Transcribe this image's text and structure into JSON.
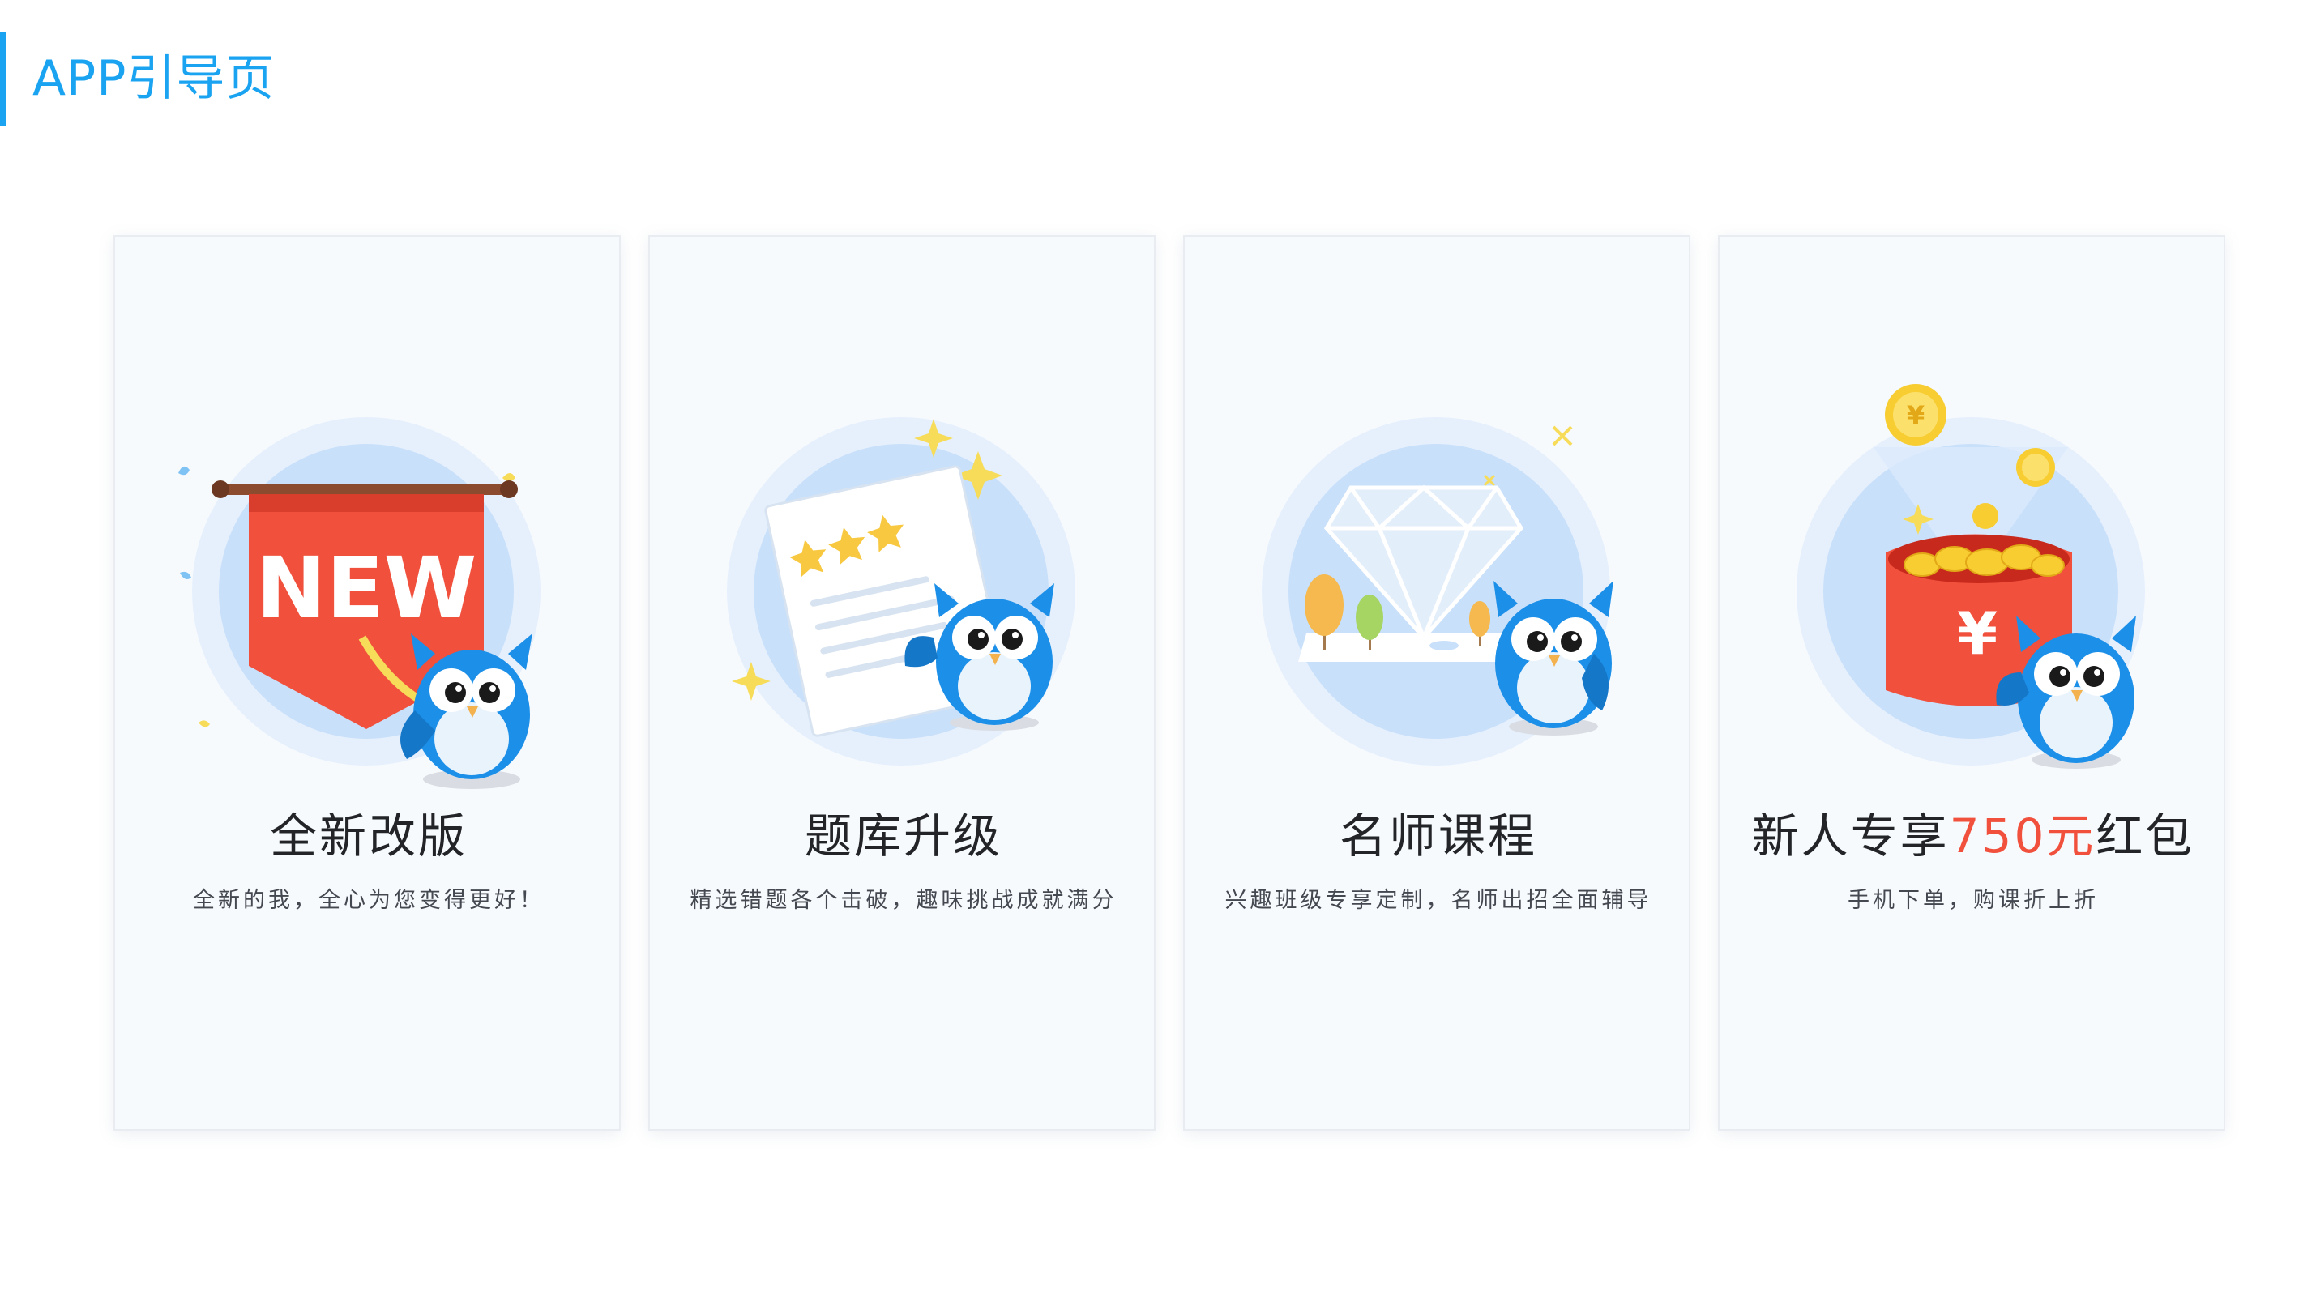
{
  "header": {
    "title": "APP引导页"
  },
  "colors": {
    "accent": "#1aa3f0",
    "card_bg": "#f7fafd",
    "highlight_red": "#f0503c",
    "circle_outer": "#e6f0fd",
    "circle_inner": "#c9e0fa",
    "owl_blue": "#1c8fe8",
    "gold": "#f7cd32"
  },
  "cards": [
    {
      "title": "全新改版",
      "subtitle": "全新的我，全心为您变得更好！",
      "illustration": "new-banner-owl",
      "banner_text": "NEW"
    },
    {
      "title": "题库升级",
      "subtitle": "精选错题各个击破，趣味挑战成就满分",
      "illustration": "exam-paper-owl"
    },
    {
      "title": "名师课程",
      "subtitle": "兴趣班级专享定制，名师出招全面辅导",
      "illustration": "diamond-owl"
    },
    {
      "title_prefix": "新人专享",
      "title_highlight": "750元",
      "title_suffix": "红包",
      "subtitle": "手机下单，购课折上折",
      "illustration": "red-envelope-owl",
      "envelope_symbol": "¥"
    }
  ]
}
